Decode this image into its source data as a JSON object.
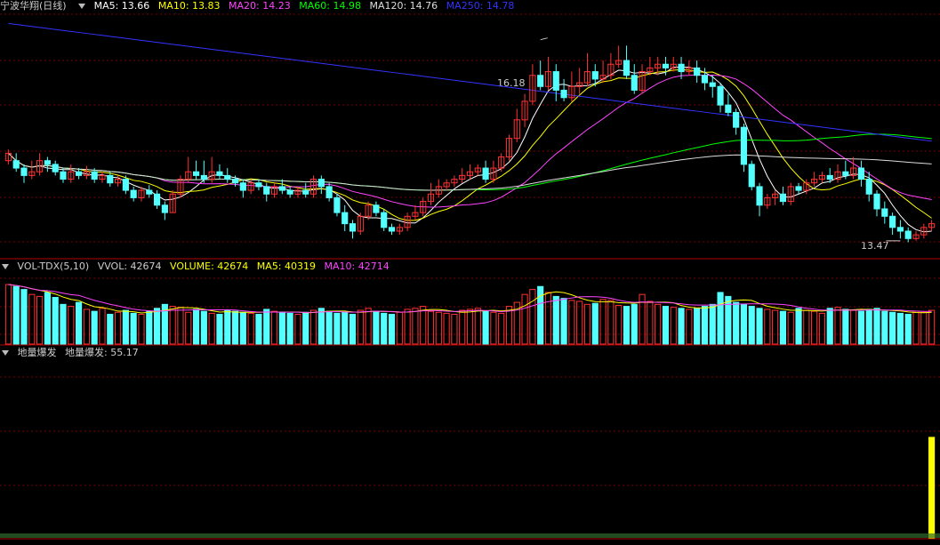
{
  "main_header": {
    "title": "宁波华翔(日线)",
    "ma5": {
      "label": "MA5: 13.66",
      "color": "#ffffff"
    },
    "ma10": {
      "label": "MA10: 13.83",
      "color": "#ffff00"
    },
    "ma20": {
      "label": "MA20: 14.23",
      "color": "#ff44ff"
    },
    "ma60": {
      "label": "MA60: 14.98",
      "color": "#00ff00"
    },
    "ma120": {
      "label": "MA120: 14.76",
      "color": "#dddddd"
    },
    "ma250": {
      "label": "MA250: 14.78",
      "color": "#3333ff"
    }
  },
  "vol_header": {
    "name": "VOL-TDX(5,10)",
    "vvol": "VVOL: 42674",
    "volume": {
      "label": "VOLUME: 42674",
      "color": "#ffff00"
    },
    "ma5": {
      "label": "MA5: 40319",
      "color": "#ffff00"
    },
    "ma10": {
      "label": "MA10: 42714",
      "color": "#ff44ff"
    }
  },
  "ind_header": {
    "name": "地量爆发",
    "value": "地量爆发: 55.17"
  },
  "annotations": {
    "high": "16.18",
    "low": "13.47"
  },
  "colors": {
    "up": "#ff3232",
    "down": "#54ffff",
    "grid": "#7a0000",
    "separator": "#b00000"
  },
  "chart_data": [
    {
      "type": "candlestick",
      "price_range": [
        13.3,
        16.5
      ],
      "ohlc": [
        [
          14.55,
          14.65,
          14.5,
          14.7
        ],
        [
          14.55,
          14.45,
          14.4,
          14.65
        ],
        [
          14.45,
          14.35,
          14.25,
          14.5
        ],
        [
          14.35,
          14.4,
          14.3,
          14.55
        ],
        [
          14.4,
          14.55,
          14.35,
          14.65
        ],
        [
          14.55,
          14.5,
          14.4,
          14.6
        ],
        [
          14.5,
          14.4,
          14.35,
          14.55
        ],
        [
          14.4,
          14.3,
          14.25,
          14.45
        ],
        [
          14.3,
          14.4,
          14.25,
          14.5
        ],
        [
          14.4,
          14.35,
          14.3,
          14.45
        ],
        [
          14.35,
          14.4,
          14.3,
          14.48
        ],
        [
          14.4,
          14.3,
          14.25,
          14.45
        ],
        [
          14.3,
          14.35,
          14.25,
          14.4
        ],
        [
          14.35,
          14.25,
          14.2,
          14.4
        ],
        [
          14.25,
          14.3,
          14.2,
          14.35
        ],
        [
          14.3,
          14.15,
          14.1,
          14.35
        ],
        [
          14.15,
          14.05,
          14.0,
          14.2
        ],
        [
          14.05,
          14.15,
          14.0,
          14.2
        ],
        [
          14.15,
          14.1,
          14.05,
          14.22
        ],
        [
          14.1,
          13.95,
          13.9,
          14.15
        ],
        [
          13.95,
          13.85,
          13.75,
          14.0
        ],
        [
          13.85,
          14.1,
          13.85,
          14.15
        ],
        [
          14.1,
          14.3,
          14.05,
          14.35
        ],
        [
          14.3,
          14.4,
          14.25,
          14.6
        ],
        [
          14.4,
          14.35,
          14.3,
          14.55
        ],
        [
          14.35,
          14.3,
          14.25,
          14.55
        ],
        [
          14.3,
          14.4,
          14.25,
          14.6
        ],
        [
          14.4,
          14.35,
          14.3,
          14.5
        ],
        [
          14.35,
          14.3,
          14.25,
          14.45
        ],
        [
          14.3,
          14.25,
          14.2,
          14.35
        ],
        [
          14.25,
          14.15,
          14.05,
          14.3
        ],
        [
          14.15,
          14.25,
          14.1,
          14.3
        ],
        [
          14.25,
          14.2,
          14.15,
          14.3
        ],
        [
          14.2,
          14.1,
          14.0,
          14.25
        ],
        [
          14.1,
          14.2,
          14.05,
          14.25
        ],
        [
          14.2,
          14.15,
          14.1,
          14.3
        ],
        [
          14.15,
          14.1,
          14.05,
          14.2
        ],
        [
          14.1,
          14.15,
          14.05,
          14.2
        ],
        [
          14.15,
          14.1,
          14.05,
          14.25
        ],
        [
          14.1,
          14.3,
          14.05,
          14.35
        ],
        [
          14.3,
          14.2,
          14.1,
          14.35
        ],
        [
          14.2,
          14.05,
          14.0,
          14.25
        ],
        [
          14.05,
          13.85,
          13.8,
          14.1
        ],
        [
          13.85,
          13.7,
          13.6,
          13.95
        ],
        [
          13.7,
          13.6,
          13.5,
          13.75
        ],
        [
          13.6,
          13.8,
          13.55,
          13.85
        ],
        [
          13.8,
          13.95,
          13.75,
          14.0
        ],
        [
          13.95,
          13.85,
          13.8,
          14.0
        ],
        [
          13.85,
          13.65,
          13.6,
          13.9
        ],
        [
          13.65,
          13.6,
          13.55,
          13.7
        ],
        [
          13.6,
          13.65,
          13.55,
          13.7
        ],
        [
          13.65,
          13.8,
          13.6,
          13.85
        ],
        [
          13.8,
          13.85,
          13.75,
          13.95
        ],
        [
          13.85,
          14.0,
          13.8,
          14.05
        ],
        [
          14.0,
          14.1,
          13.95,
          14.25
        ],
        [
          14.1,
          14.2,
          14.05,
          14.3
        ],
        [
          14.2,
          14.25,
          14.15,
          14.3
        ],
        [
          14.25,
          14.3,
          14.2,
          14.35
        ],
        [
          14.3,
          14.35,
          14.25,
          14.45
        ],
        [
          14.35,
          14.4,
          14.3,
          14.5
        ],
        [
          14.4,
          14.45,
          14.35,
          14.5
        ],
        [
          14.45,
          14.3,
          14.25,
          14.55
        ],
        [
          14.3,
          14.45,
          14.25,
          14.55
        ],
        [
          14.45,
          14.6,
          14.4,
          14.65
        ],
        [
          14.6,
          14.85,
          14.55,
          14.9
        ],
        [
          14.85,
          15.1,
          14.8,
          15.25
        ],
        [
          15.1,
          15.35,
          15.0,
          15.45
        ],
        [
          15.35,
          15.7,
          15.3,
          15.85
        ],
        [
          15.7,
          15.55,
          15.5,
          15.9
        ],
        [
          15.55,
          15.75,
          15.5,
          15.95
        ],
        [
          15.75,
          15.5,
          15.35,
          15.85
        ],
        [
          15.5,
          15.4,
          15.35,
          15.65
        ],
        [
          15.4,
          15.55,
          15.35,
          15.75
        ],
        [
          15.55,
          15.6,
          15.45,
          15.8
        ],
        [
          15.6,
          15.75,
          15.55,
          16.0
        ],
        [
          15.75,
          15.65,
          15.55,
          15.85
        ],
        [
          15.65,
          15.7,
          15.6,
          15.9
        ],
        [
          15.7,
          15.85,
          15.65,
          16.0
        ],
        [
          15.85,
          15.9,
          15.8,
          16.1
        ],
        [
          15.9,
          15.7,
          15.65,
          16.1
        ],
        [
          15.7,
          15.5,
          15.45,
          15.85
        ],
        [
          15.5,
          15.75,
          15.45,
          15.85
        ],
        [
          15.75,
          15.8,
          15.7,
          15.95
        ],
        [
          15.8,
          15.85,
          15.7,
          15.95
        ],
        [
          15.85,
          15.8,
          15.7,
          15.95
        ],
        [
          15.8,
          15.85,
          15.75,
          15.95
        ],
        [
          15.85,
          15.75,
          15.65,
          15.95
        ],
        [
          15.75,
          15.8,
          15.7,
          15.9
        ],
        [
          15.8,
          15.7,
          15.6,
          15.9
        ],
        [
          15.7,
          15.6,
          15.5,
          15.8
        ],
        [
          15.6,
          15.55,
          15.4,
          15.7
        ],
        [
          15.55,
          15.3,
          15.2,
          15.6
        ],
        [
          15.3,
          15.2,
          15.15,
          15.45
        ],
        [
          15.2,
          15.0,
          14.9,
          15.25
        ],
        [
          15.0,
          14.5,
          14.4,
          15.05
        ],
        [
          14.5,
          14.2,
          14.15,
          14.55
        ],
        [
          14.2,
          13.95,
          13.8,
          14.25
        ],
        [
          13.95,
          14.05,
          13.9,
          14.1
        ],
        [
          14.05,
          14.1,
          13.95,
          14.15
        ],
        [
          14.1,
          14.0,
          13.95,
          14.2
        ],
        [
          14.0,
          14.2,
          13.95,
          14.25
        ],
        [
          14.2,
          14.15,
          14.1,
          14.25
        ],
        [
          14.15,
          14.25,
          14.1,
          14.3
        ],
        [
          14.25,
          14.3,
          14.2,
          14.4
        ],
        [
          14.3,
          14.35,
          14.25,
          14.4
        ],
        [
          14.35,
          14.3,
          14.25,
          14.45
        ],
        [
          14.3,
          14.4,
          14.25,
          14.5
        ],
        [
          14.4,
          14.35,
          14.3,
          14.55
        ],
        [
          14.35,
          14.45,
          14.3,
          14.6
        ],
        [
          14.45,
          14.3,
          14.2,
          14.55
        ],
        [
          14.3,
          14.1,
          14.0,
          14.4
        ],
        [
          14.1,
          13.9,
          13.8,
          14.15
        ],
        [
          13.9,
          13.8,
          13.7,
          14.0
        ],
        [
          13.8,
          13.65,
          13.55,
          13.85
        ],
        [
          13.65,
          13.6,
          13.5,
          13.75
        ],
        [
          13.6,
          13.5,
          13.45,
          13.65
        ],
        [
          13.5,
          13.55,
          13.47,
          13.6
        ],
        [
          13.55,
          13.65,
          13.5,
          13.7
        ],
        [
          13.65,
          13.7,
          13.6,
          13.75
        ]
      ],
      "volume": [
        60,
        58,
        55,
        50,
        48,
        52,
        47,
        40,
        38,
        42,
        35,
        33,
        36,
        30,
        32,
        34,
        31,
        30,
        33,
        36,
        40,
        38,
        37,
        32,
        35,
        33,
        31,
        30,
        34,
        33,
        32,
        31,
        30,
        35,
        33,
        32,
        31,
        30,
        32,
        34,
        36,
        33,
        31,
        32,
        30,
        34,
        36,
        33,
        31,
        30,
        32,
        35,
        36,
        38,
        33,
        32,
        31,
        30,
        34,
        35,
        36,
        33,
        32,
        31,
        38,
        42,
        50,
        55,
        58,
        52,
        48,
        46,
        44,
        43,
        40,
        41,
        45,
        44,
        39,
        38,
        40,
        50,
        43,
        40,
        38,
        37,
        36,
        35,
        36,
        38,
        40,
        52,
        48,
        42,
        40,
        38,
        36,
        35,
        34,
        33,
        32,
        36,
        34,
        33,
        31,
        36,
        37,
        35,
        34,
        33,
        35,
        36,
        33,
        32,
        31,
        30,
        33,
        32,
        34
      ],
      "indicator": [
        0,
        0,
        0,
        0,
        0,
        0,
        0,
        0,
        0,
        0,
        0,
        0,
        0,
        0,
        0,
        0,
        0,
        0,
        0,
        0,
        0,
        0,
        0,
        0,
        0,
        0,
        0,
        0,
        0,
        0,
        0,
        0,
        0,
        0,
        0,
        0,
        0,
        0,
        0,
        0,
        0,
        0,
        0,
        0,
        0,
        0,
        0,
        0,
        0,
        0,
        0,
        0,
        0,
        0,
        0,
        0,
        0,
        0,
        0,
        0,
        0,
        0,
        0,
        0,
        0,
        0,
        0,
        0,
        0,
        0,
        0,
        0,
        0,
        0,
        0,
        0,
        0,
        0,
        0,
        0,
        0,
        0,
        0,
        0,
        0,
        0,
        0,
        0,
        0,
        0,
        0,
        0,
        0,
        0,
        0,
        0,
        0,
        0,
        0,
        0,
        0,
        0,
        0,
        0,
        0,
        0,
        0,
        0,
        0,
        0,
        0,
        0,
        0,
        0,
        0,
        0,
        0,
        0,
        55.17
      ]
    }
  ]
}
